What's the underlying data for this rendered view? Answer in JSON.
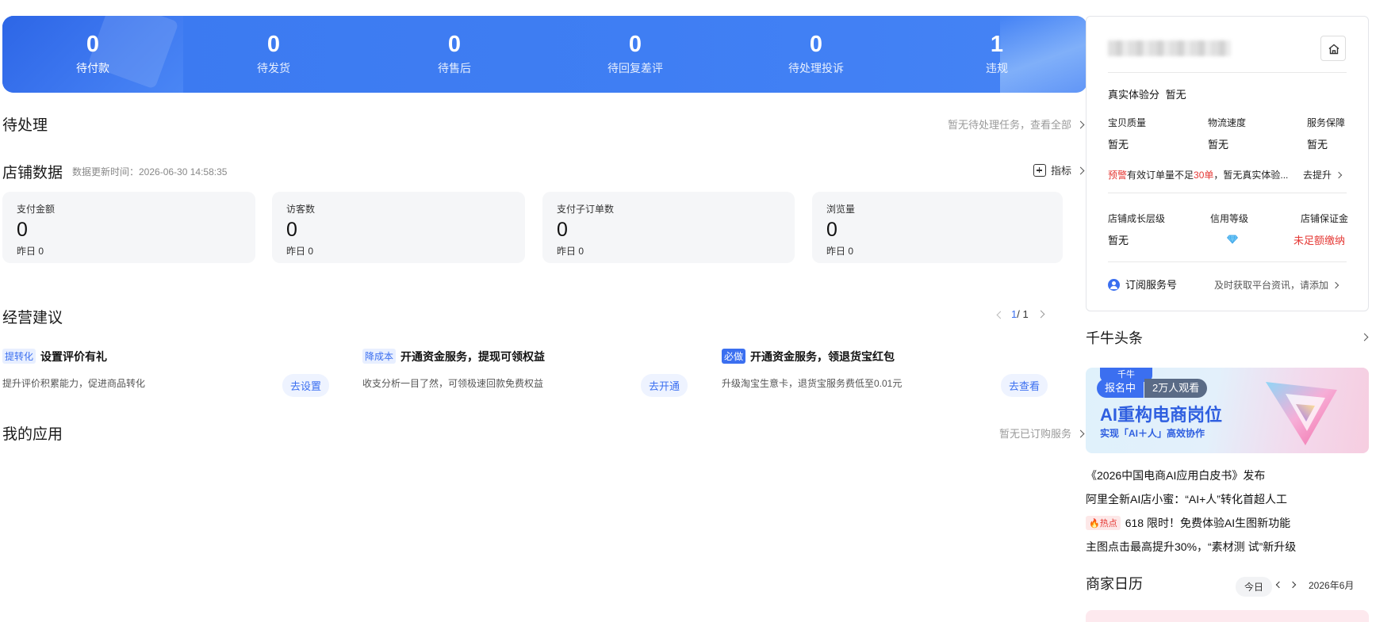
{
  "banner": {
    "stats": [
      {
        "value": "0",
        "label": "待付款"
      },
      {
        "value": "0",
        "label": "待发货"
      },
      {
        "value": "0",
        "label": "待售后"
      },
      {
        "value": "0",
        "label": "待回复差评"
      },
      {
        "value": "0",
        "label": "待处理投诉"
      },
      {
        "value": "1",
        "label": "违规"
      }
    ]
  },
  "pending": {
    "title": "待处理",
    "link": "暂无待处理任务，查看全部"
  },
  "shop_data": {
    "title": "店铺数据",
    "updated": "数据更新时间：2026-06-30 14:58:35",
    "metric_link": "指标",
    "cards": [
      {
        "label": "支付金额",
        "value": "0",
        "yesterday": "昨日 0"
      },
      {
        "label": "访客数",
        "value": "0",
        "yesterday": "昨日 0"
      },
      {
        "label": "支付子订单数",
        "value": "0",
        "yesterday": "昨日 0"
      },
      {
        "label": "浏览量",
        "value": "0",
        "yesterday": "昨日 0"
      }
    ]
  },
  "suggestions": {
    "title": "经营建议",
    "pager": "1",
    "pager_total": "/ 1",
    "items": [
      {
        "tag": "提转化",
        "title": "设置评价有礼",
        "desc": "提升评价积累能力，促进商品转化",
        "button": "去设置"
      },
      {
        "tag": "降成本",
        "title": "开通资金服务，提现可领权益",
        "desc": "收支分析一目了然，可领极速回款免费权益",
        "button": "去开通"
      },
      {
        "tag": "必做",
        "title": "开通资金服务，领退货宝红包",
        "desc": "升级淘宝生意卡，退货宝服务费低至0.01元",
        "button": "去查看"
      }
    ]
  },
  "apps": {
    "title": "我的应用",
    "link": "暂无已订购服务"
  },
  "right_panel": {
    "experience_label": "真实体验分",
    "experience_value": "暂无",
    "scores": [
      {
        "label": "宝贝质量",
        "value": "暂无"
      },
      {
        "label": "物流速度",
        "value": "暂无"
      },
      {
        "label": "服务保障",
        "value": "暂无"
      }
    ],
    "warning": {
      "prefix": "预警",
      "text1": "有效订单量不足",
      "highlight": "30单",
      "text2": "，暂无真实体验...",
      "action": "去提升"
    },
    "levels": [
      {
        "label": "店铺成长层级",
        "value": "暂无"
      },
      {
        "label": "信用等级",
        "value": ""
      },
      {
        "label": "店铺保证金",
        "value": "未足额缴纳"
      }
    ],
    "subscribe": {
      "label": "订阅服务号",
      "desc": "及时获取平台资讯，请添加"
    }
  },
  "headlines": {
    "title": "千牛头条",
    "banner": {
      "chip": "千牛",
      "badge1": "报名中",
      "badge2": "2万人观看",
      "big": "AI重构电商岗位",
      "small": "实现「AI＋人」高效协作"
    },
    "items": [
      {
        "text": "《2026中国电商AI应用白皮书》发布"
      },
      {
        "text": "阿里全新AI店小蜜：“AI+人”转化首超人工"
      },
      {
        "tag": "热点",
        "text": "618 限时！免费体验AI生图新功能"
      },
      {
        "text": "主图点击最高提升30%，“素材测 试”新升级"
      }
    ]
  },
  "calendar": {
    "title": "商家日历",
    "today": "今日",
    "month": "2026年6月"
  },
  "colors": {
    "primary": "#3b6ff0",
    "banner": "#3f7ef3",
    "warning": "#e53935"
  }
}
